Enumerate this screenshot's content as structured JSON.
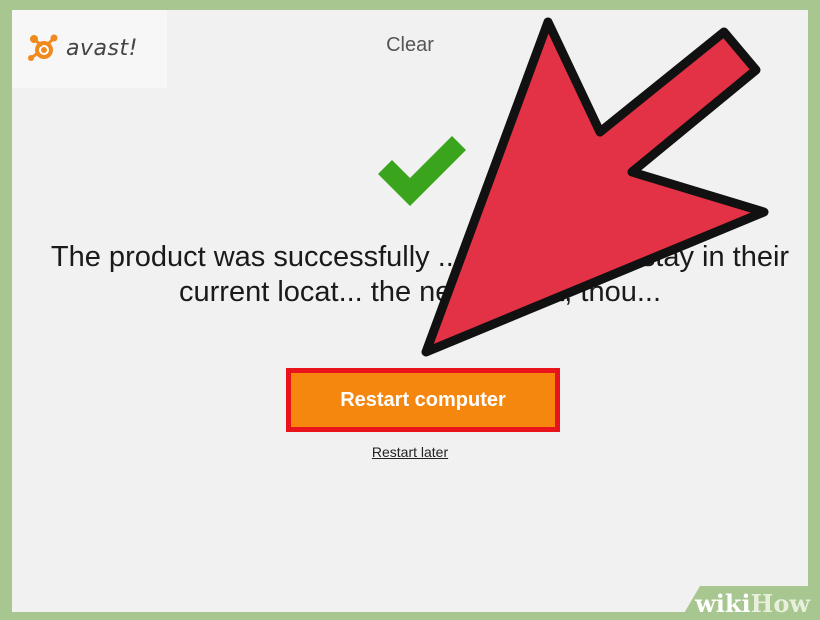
{
  "app": {
    "logo_text": "avast!",
    "window_title": "Clear"
  },
  "main": {
    "message": "The product was successfully ... the files may stay in their current locat... the next reboot, thou...",
    "restart_button_label": "Restart computer",
    "restart_later_label": "Restart later"
  },
  "watermark": {
    "wiki": "wiki",
    "how": "How"
  },
  "colors": {
    "accent_orange": "#f5870f",
    "highlight_red": "#e8131b",
    "success_green": "#3aa51c",
    "arrow_red": "#e33245",
    "frame_green": "#a8c68f"
  },
  "icons": [
    "avast-logo-icon",
    "success-checkmark-icon",
    "pointer-arrow-icon"
  ]
}
